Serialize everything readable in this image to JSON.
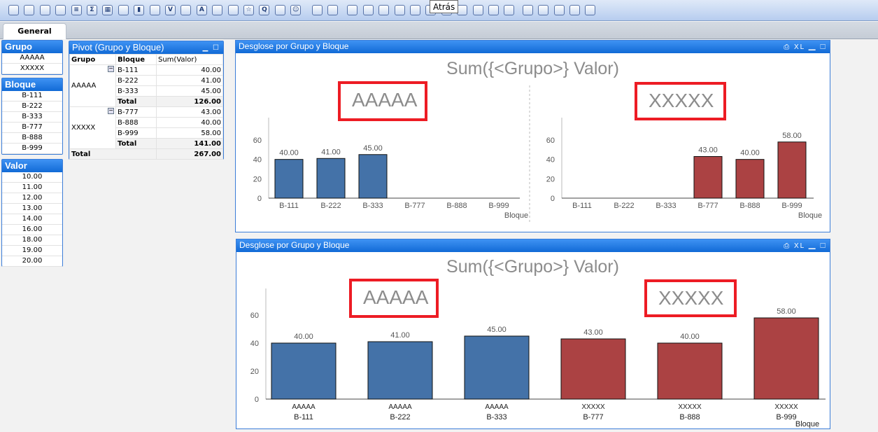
{
  "toolbar": {
    "icons": [
      "new-doc",
      "back",
      "forward",
      "open",
      "listbox",
      "sum",
      "table",
      "multibox",
      "chart",
      "input",
      "check",
      "current-sel",
      "text",
      "button-list",
      "slider",
      "bookmark",
      "search",
      "container",
      "smiley",
      "wizard",
      "brush",
      "select",
      "align-left",
      "align-center",
      "align-right",
      "align-bottom",
      "align-top",
      "distribute-h",
      "distribute-v",
      "space",
      "adjust",
      "move",
      "edit-script",
      "reload",
      "properties",
      "network",
      "export"
    ],
    "tooltip": "Atrás"
  },
  "tabs": [
    {
      "label": "General"
    }
  ],
  "listboxes": {
    "grupo": {
      "title": "Grupo",
      "items": [
        "AAAAA",
        "XXXXX"
      ]
    },
    "bloque": {
      "title": "Bloque",
      "items": [
        "B-111",
        "B-222",
        "B-333",
        "B-777",
        "B-888",
        "B-999"
      ]
    },
    "valor": {
      "title": "Valor",
      "items": [
        "10.00",
        "11.00",
        "12.00",
        "13.00",
        "14.00",
        "16.00",
        "18.00",
        "19.00",
        "20.00"
      ]
    }
  },
  "pivot": {
    "title": "Pivot (Grupo y Bloque)",
    "headers": [
      "Grupo",
      "Bloque",
      "Sum(Valor)"
    ],
    "groups": [
      {
        "name": "AAAAA",
        "rows": [
          [
            "B-111",
            "40.00"
          ],
          [
            "B-222",
            "41.00"
          ],
          [
            "B-333",
            "45.00"
          ]
        ],
        "total_label": "Total",
        "total": "126.00"
      },
      {
        "name": "XXXXX",
        "rows": [
          [
            "B-777",
            "43.00"
          ],
          [
            "B-888",
            "40.00"
          ],
          [
            "B-999",
            "58.00"
          ]
        ],
        "total_label": "Total",
        "total": "141.00"
      }
    ],
    "grand_total_label": "Total",
    "grand_total": "267.00"
  },
  "charts": {
    "caption": "Desglose por  Grupo y Bloque",
    "caption_icons": "⎙ XL ▁ ☐",
    "title": "Sum({<Grupo>} Valor)",
    "colors": {
      "AAAAA": "#4472a8",
      "XXXXX": "#ab4243"
    }
  },
  "chart_data": [
    {
      "type": "bar",
      "title": "Sum({<Grupo>} Valor)",
      "trellis": true,
      "xlabel": "Bloque",
      "ylim": [
        0,
        80
      ],
      "yticks": [
        0,
        20,
        40,
        60
      ],
      "categories": [
        "B-111",
        "B-222",
        "B-333",
        "B-777",
        "B-888",
        "B-999"
      ],
      "panels": [
        {
          "name": "AAAAA",
          "values": [
            40,
            41,
            45,
            null,
            null,
            null
          ]
        },
        {
          "name": "XXXXX",
          "values": [
            null,
            null,
            null,
            43,
            40,
            58
          ]
        }
      ]
    },
    {
      "type": "bar",
      "title": "Sum({<Grupo>} Valor)",
      "xlabel": "Bloque",
      "ylim": [
        0,
        80
      ],
      "yticks": [
        0,
        20,
        40,
        60
      ],
      "categories": [
        [
          "AAAAA",
          "B-111"
        ],
        [
          "AAAAA",
          "B-222"
        ],
        [
          "AAAAA",
          "B-333"
        ],
        [
          "XXXXX",
          "B-777"
        ],
        [
          "XXXXX",
          "B-888"
        ],
        [
          "XXXXX",
          "B-999"
        ]
      ],
      "values": [
        40,
        41,
        45,
        43,
        40,
        58
      ],
      "legend_boxes": [
        "AAAAA",
        "XXXXX"
      ]
    }
  ]
}
